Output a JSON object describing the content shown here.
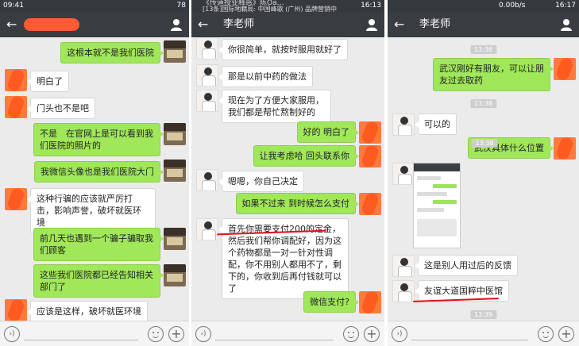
{
  "panel1": {
    "status": {
      "time": "09:41",
      "right": "78"
    },
    "messages": [
      {
        "text": "这根本就不是我们医院"
      },
      {
        "text": "明白了"
      },
      {
        "text": "门头也不是吧"
      },
      {
        "text": "不是　在官网上是可以看到我们医院的照片的"
      },
      {
        "text": "我微信头像也是我们医院大门"
      },
      {
        "text": "这种行骗的应该就严厉打击，影响声誉，破坏就医环境"
      },
      {
        "text": "前几天也遇到一个骗子骗取我们顾客"
      },
      {
        "text": "这些我们医院都已经告知相关部门了"
      },
      {
        "text": "应该是这样，破坏就医环境"
      }
    ]
  },
  "panel2": {
    "status": {
      "ticker": "《传道授业释惑》陈Oa…",
      "ticker2": "[13条]国际地籍局: 中国峰歌 (广州) 品牌营销中心",
      "right": "16:13"
    },
    "title": "李老师",
    "messages": [
      {
        "text": "你很简单，就按时服用就好了"
      },
      {
        "text": "那是以前中药的做法"
      },
      {
        "text": "现在为了方便大家服用，我们都是帮忙熬制好的"
      },
      {
        "text": "好的 明白了"
      },
      {
        "text": "让我考虑哈 回头联系你"
      },
      {
        "text": "嗯嗯，你自己决定"
      },
      {
        "text": "如果不过来 到时候怎么支付"
      },
      {
        "text": "首先你需要支付200的定金，然后我们帮你调配好，因为这个药物都是一对一针对性调配，你不用别人都用不了，剩下的，你收到后再付钱就可以了"
      },
      {
        "text": "微信支付?"
      }
    ]
  },
  "panel3": {
    "status": {
      "left": "0.00b/s",
      "right": "16:17"
    },
    "title": "李老师",
    "times": [
      "13:36",
      "13:38",
      "13:38",
      "13:39"
    ],
    "messages": [
      {
        "text": "武汉刚好有朋友，可以让朋友过去取药"
      },
      {
        "text": "可以的"
      },
      {
        "text": "武汉具体什么位置"
      },
      {
        "text": "这是别人用过后的反馈"
      },
      {
        "text": "友谊大道国粹中医馆"
      }
    ]
  },
  "input": {
    "voice_icon": "voice-icon",
    "emoji_icon": "emoji-icon",
    "plus_icon": "plus-icon"
  }
}
